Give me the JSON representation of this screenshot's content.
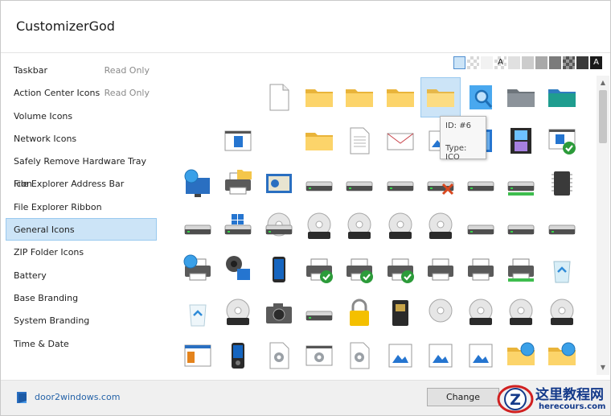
{
  "window": {
    "title": "CustomizerGod"
  },
  "sidebar": {
    "items": [
      {
        "label": "Taskbar",
        "badge": "Read Only",
        "active": false
      },
      {
        "label": "Action Center Icons",
        "badge": "Read Only",
        "active": false
      },
      {
        "label": "Volume Icons",
        "badge": "",
        "active": false
      },
      {
        "label": "Network Icons",
        "badge": "",
        "active": false
      },
      {
        "label": "Safely Remove Hardware Tray Icon",
        "badge": "",
        "active": false
      },
      {
        "label": "File Explorer Address Bar",
        "badge": "",
        "active": false
      },
      {
        "label": "File Explorer Ribbon",
        "badge": "",
        "active": false
      },
      {
        "label": "General Icons",
        "badge": "",
        "active": true
      },
      {
        "label": "ZIP Folder Icons",
        "badge": "",
        "active": false
      },
      {
        "label": "Battery",
        "badge": "",
        "active": false
      },
      {
        "label": "Base Branding",
        "badge": "",
        "active": false
      },
      {
        "label": "System Branding",
        "badge": "",
        "active": false
      },
      {
        "label": "Time & Date",
        "badge": "",
        "active": false
      }
    ]
  },
  "background_swatches": [
    {
      "color": "#cce4f7",
      "label": "",
      "selected": true
    },
    {
      "color": "checker",
      "label": "",
      "selected": false
    },
    {
      "color": "#f2f2f2",
      "label": "",
      "selected": false
    },
    {
      "color": "checker",
      "label": "A",
      "selected": false
    },
    {
      "color": "#e0e0e0",
      "label": "",
      "selected": false
    },
    {
      "color": "#cccccc",
      "label": "",
      "selected": false
    },
    {
      "color": "#a9a9a9",
      "label": "",
      "selected": false
    },
    {
      "color": "#7b7b7b",
      "label": "",
      "selected": false
    },
    {
      "color": "checker-dark",
      "label": "",
      "selected": false
    },
    {
      "color": "#3a3a3a",
      "label": "",
      "selected": false
    },
    {
      "color": "#1a1a1a",
      "label": "A",
      "selected": false
    }
  ],
  "icon_grid": {
    "rows": [
      [
        "empty",
        "empty",
        "document-icon",
        "folder-icon",
        "folder-icon",
        "folder-icon",
        "folder-open-icon",
        "search-folder-icon",
        "folder-gray-icon",
        "folder-green-icon"
      ],
      [
        "empty",
        "app-window-icon",
        "empty",
        "folder-icon",
        "text-document-icon",
        "mail-icon",
        "picture-icon",
        "video-folder-icon",
        "film-strip-icon",
        "app-check-icon"
      ],
      [
        "globe-monitor-icon",
        "printer-folder-icon",
        "control-panel-icon",
        "drive-icon",
        "drive-icon",
        "drive-icon",
        "drive-x-icon",
        "drive-icon",
        "drive-green-icon",
        "chip-icon"
      ],
      [
        "drive-icon",
        "windows-drive-icon",
        "dvd-drive-icon",
        "dvd-r-icon",
        "dvd-ram-icon",
        "dvd-rom-icon",
        "dvd-rw-icon",
        "drive-icon",
        "drive-icon",
        "drive-icon"
      ],
      [
        "globe-printer-icon",
        "webcam-icon",
        "phone-icon",
        "printer-check-icon",
        "printer-check-icon",
        "printer-check-icon",
        "printer-icon",
        "printer-icon",
        "printer-green-icon",
        "recycle-bin-full-icon"
      ],
      [
        "recycle-bin-icon",
        "dvd-icon",
        "camera-icon",
        "drive-icon",
        "lock-icon",
        "memory-card-icon",
        "cd-icon",
        "cd-r-icon",
        "cd-rom-icon",
        "cd-rw-icon"
      ],
      [
        "certificate-icon",
        "media-player-icon",
        "settings-doc-icon",
        "settings-window-icon",
        "settings-doc-icon",
        "image-icon",
        "image-icon",
        "image-icon",
        "network-folder-icon",
        "network-folder-icon"
      ]
    ],
    "selected": {
      "row": 0,
      "col": 6
    }
  },
  "tooltip": {
    "id_text": "ID: #6",
    "type_text": "Type: ICO"
  },
  "footer": {
    "link_text": "door2windows.com",
    "change_label": "Change"
  },
  "watermark": {
    "title": "这里教程网",
    "subtitle": "herecours.com",
    "logo_letter": "Z"
  }
}
